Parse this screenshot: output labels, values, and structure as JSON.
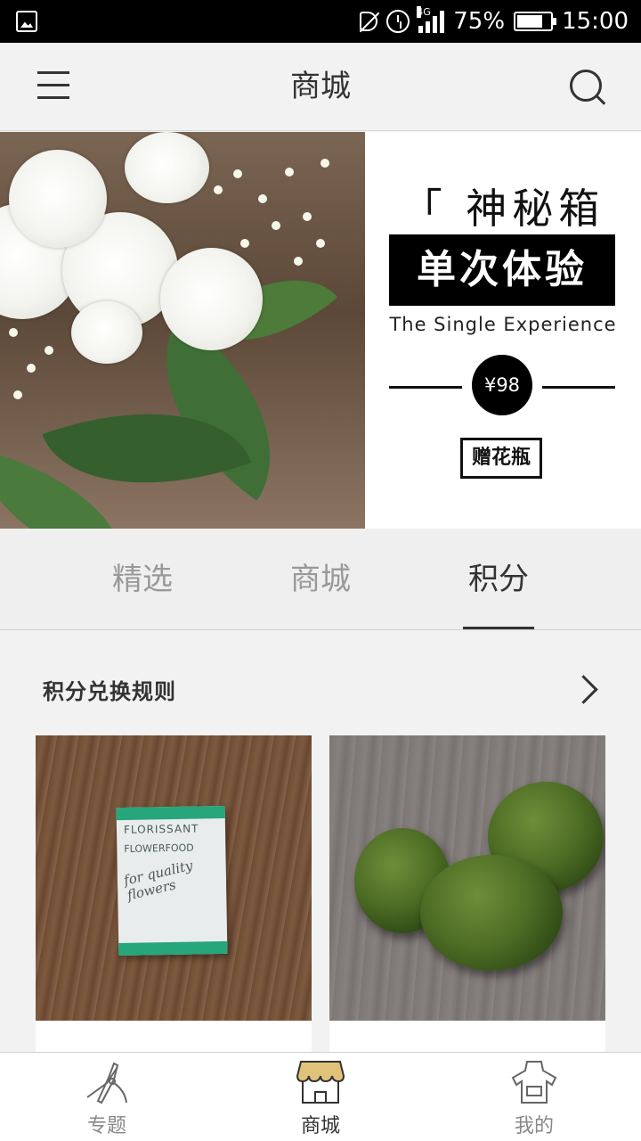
{
  "status_bar": {
    "battery": "75%",
    "time": "15:00",
    "network": "4G"
  },
  "header": {
    "title": "商城"
  },
  "banner": {
    "mystery_box": "「 神秘箱 」",
    "single_experience_cn": "单次体验",
    "single_experience_en": "The Single Experience",
    "price": "¥98",
    "gift": "赠花瓶"
  },
  "tabs": [
    {
      "label": "精选",
      "active": false
    },
    {
      "label": "商城",
      "active": false
    },
    {
      "label": "积分",
      "active": true
    }
  ],
  "rules": {
    "label": "积分兑换规则"
  },
  "products": [
    {
      "image": "flower-food-packet",
      "packet_brand": "FLORISSANT",
      "packet_sub": "FLOWERFOOD",
      "packet_script": "for quality flowers"
    },
    {
      "image": "moss-balls"
    }
  ],
  "bottom_nav": [
    {
      "label": "专题",
      "icon": "pruning-shears-icon",
      "active": false
    },
    {
      "label": "商城",
      "icon": "shop-awning-icon",
      "active": true
    },
    {
      "label": "我的",
      "icon": "apron-icon",
      "active": false
    }
  ],
  "colors": {
    "tab_active": "#333333",
    "tab_inactive": "#999999",
    "awning": "#e0c27a"
  }
}
